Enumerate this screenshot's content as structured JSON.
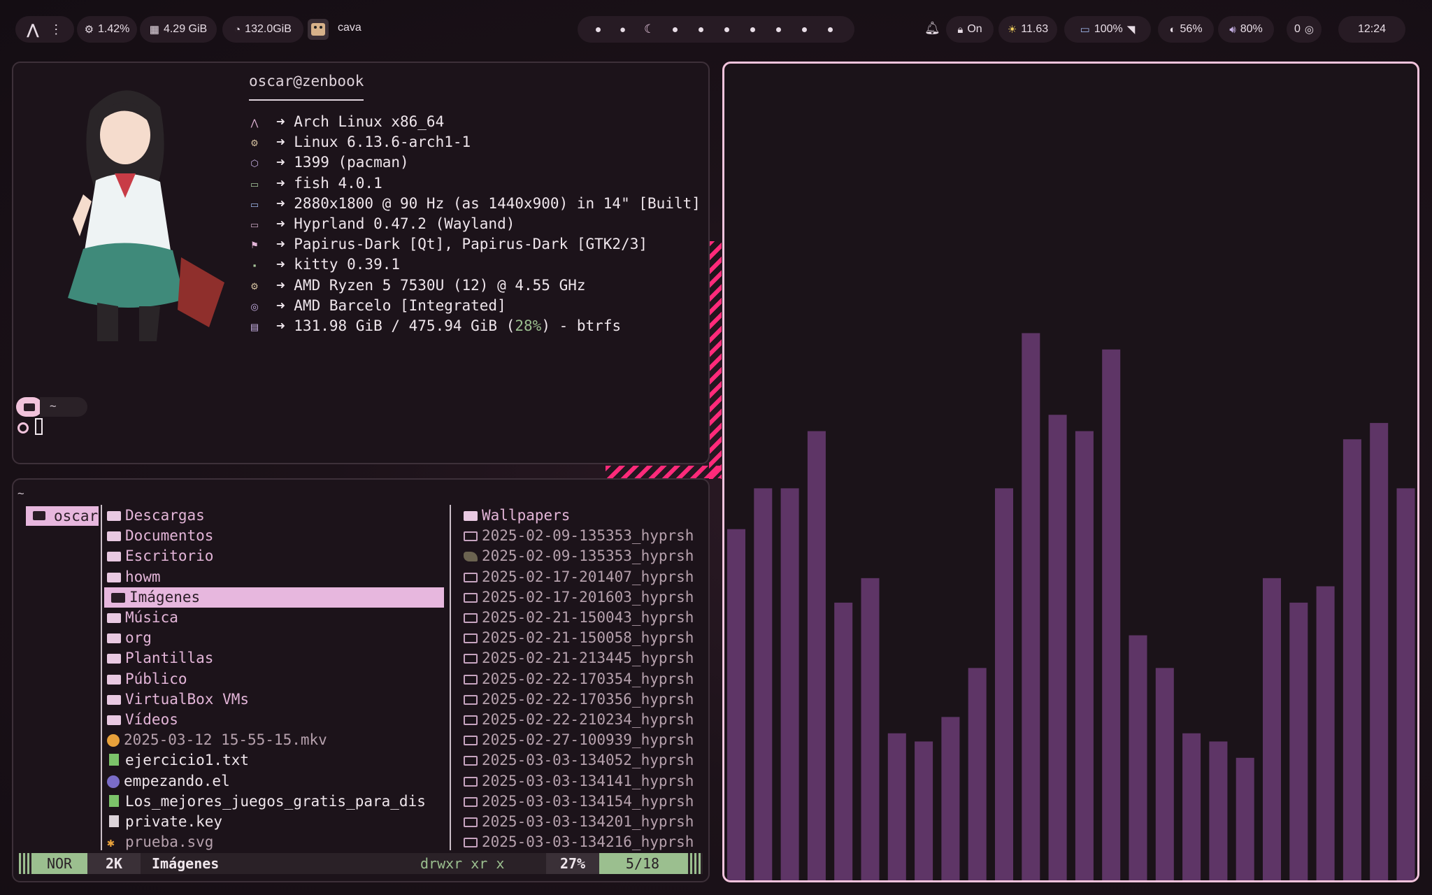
{
  "topbar": {
    "cpu": "1.42%",
    "memory": "4.29 GiB",
    "disk": "132.0GiB",
    "active_app": "cava",
    "lock_status": "On",
    "weather": "11.63",
    "battery": "100%",
    "brightness": "56%",
    "volume": "80%",
    "notifications_count": "0",
    "clock": "12:24"
  },
  "fastfetch": {
    "user_host": "oscar@zenbook",
    "lines": [
      {
        "icon": "arch-icon",
        "text": "➜ Arch Linux x86_64"
      },
      {
        "icon": "gear-icon",
        "text": "➜ Linux 6.13.6-arch1-1"
      },
      {
        "icon": "package-icon",
        "text": "➜ 1399 (pacman)"
      },
      {
        "icon": "shell-icon",
        "text": "➜ fish 4.0.1"
      },
      {
        "icon": "monitor-icon",
        "text": "➜ 2880x1800 @ 90 Hz (as 1440x900) in 14\" [Built]"
      },
      {
        "icon": "window-icon",
        "text": "➜ Hyprland 0.47.2 (Wayland)"
      },
      {
        "icon": "flag-icon",
        "text": "➜ Papirus-Dark [Qt], Papirus-Dark [GTK2/3]"
      },
      {
        "icon": "terminal-icon",
        "text": "➜ kitty 0.39.1"
      },
      {
        "icon": "cpu-icon",
        "text": "➜ AMD Ryzen 5 7530U (12) @ 4.55 GHz"
      },
      {
        "icon": "gpu-icon",
        "text": "➜ AMD Barcelo [Integrated]"
      }
    ],
    "disk_line": {
      "prefix": "➜ 131.98 GiB / 475.94 GiB (",
      "percent": "28%",
      "suffix": ") - btrfs"
    },
    "prompt_dir": "~"
  },
  "yazi": {
    "cwd": "~",
    "parent": "oscar",
    "entries": [
      {
        "name": "Descargas",
        "kind": "dir"
      },
      {
        "name": "Documentos",
        "kind": "dir"
      },
      {
        "name": "Escritorio",
        "kind": "dir"
      },
      {
        "name": "howm",
        "kind": "dir"
      },
      {
        "name": "Imágenes",
        "kind": "dir"
      },
      {
        "name": "Música",
        "kind": "dir"
      },
      {
        "name": "org",
        "kind": "dir"
      },
      {
        "name": "Plantillas",
        "kind": "dir"
      },
      {
        "name": "Público",
        "kind": "dir"
      },
      {
        "name": "VirtualBox VMs",
        "kind": "dir"
      },
      {
        "name": "Vídeos",
        "kind": "dir"
      },
      {
        "name": "2025-03-12 15-55-15.mkv",
        "kind": "video"
      },
      {
        "name": "ejercicio1.txt",
        "kind": "text"
      },
      {
        "name": "empezando.el",
        "kind": "elisp"
      },
      {
        "name": "Los_mejores_juegos_gratis_para_dis",
        "kind": "text"
      },
      {
        "name": "private.key",
        "kind": "key"
      },
      {
        "name": "prueba.svg",
        "kind": "svg"
      }
    ],
    "preview": [
      {
        "name": "Wallpapers",
        "kind": "dir"
      },
      {
        "name": "2025-02-09-135353_hyprsh",
        "kind": "img"
      },
      {
        "name": "2025-02-09-135353_hyprsh",
        "kind": "img2"
      },
      {
        "name": "2025-02-17-201407_hyprsh",
        "kind": "img"
      },
      {
        "name": "2025-02-17-201603_hyprsh",
        "kind": "img"
      },
      {
        "name": "2025-02-21-150043_hyprsh",
        "kind": "img"
      },
      {
        "name": "2025-02-21-150058_hyprsh",
        "kind": "img"
      },
      {
        "name": "2025-02-21-213445_hyprsh",
        "kind": "img"
      },
      {
        "name": "2025-02-22-170354_hyprsh",
        "kind": "img"
      },
      {
        "name": "2025-02-22-170356_hyprsh",
        "kind": "img"
      },
      {
        "name": "2025-02-22-210234_hyprsh",
        "kind": "img"
      },
      {
        "name": "2025-02-27-100939_hyprsh",
        "kind": "img"
      },
      {
        "name": "2025-03-03-134052_hyprsh",
        "kind": "img"
      },
      {
        "name": "2025-03-03-134141_hyprsh",
        "kind": "img"
      },
      {
        "name": "2025-03-03-134154_hyprsh",
        "kind": "img"
      },
      {
        "name": "2025-03-03-134201_hyprsh",
        "kind": "img"
      },
      {
        "name": "2025-03-03-134216_hyprsh",
        "kind": "img"
      }
    ],
    "status": {
      "mode": "NOR",
      "size": "2K",
      "selected": "Imágenes",
      "permissions": "drwxr xr x",
      "percent": "27%",
      "position": "5/18"
    }
  },
  "cava": {
    "levels": [
      0.43,
      0.48,
      0.48,
      0.55,
      0.34,
      0.37,
      0.18,
      0.17,
      0.2,
      0.26,
      0.48,
      0.67,
      0.57,
      0.55,
      0.65,
      0.3,
      0.26,
      0.18,
      0.17,
      0.15,
      0.37,
      0.34,
      0.36,
      0.54,
      0.56,
      0.48
    ]
  },
  "colors": {
    "accent": "#f2c3dc",
    "green": "#9bbf8f",
    "bar_top": "#6e4050",
    "bar_bottom": "#6a3b73"
  }
}
